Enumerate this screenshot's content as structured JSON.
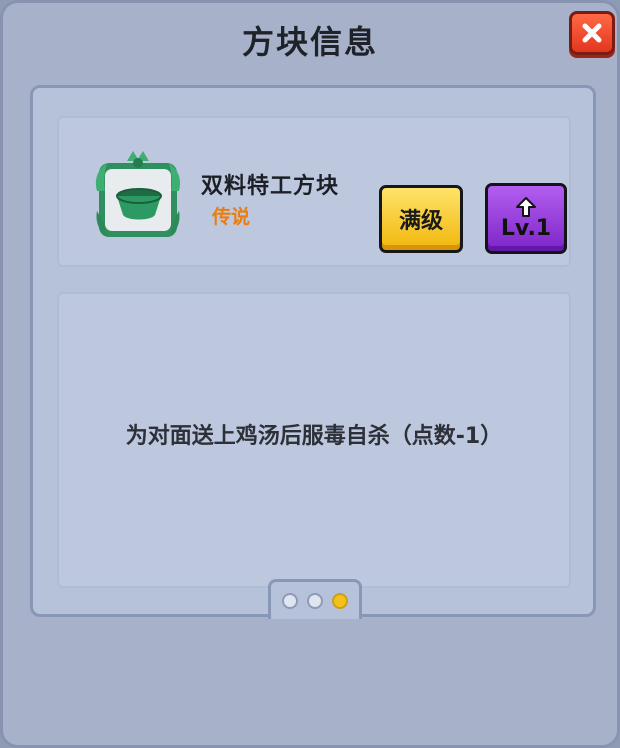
{
  "dialog": {
    "title": "方块信息",
    "close_icon": "close-icon"
  },
  "item": {
    "name": "双料特工方块",
    "rarity": "传说",
    "rarity_color": "#e97d10",
    "icon": "green-bowl-icon",
    "frame": "dragon-frame-icon"
  },
  "buttons": {
    "max_label": "满级",
    "level_label": "Lv.1",
    "level_icon": "up-arrow-icon"
  },
  "description": {
    "text": "为对面送上鸡汤后服毒自杀（点数-1）"
  },
  "pager": {
    "pages": 3,
    "current": 3
  },
  "colors": {
    "dialog_bg": "#a7b2ca",
    "close_button": "#e2361f",
    "max_button": "#f1b60c",
    "level_button": "#7e25c8",
    "active_dot": "#f2c21b"
  }
}
